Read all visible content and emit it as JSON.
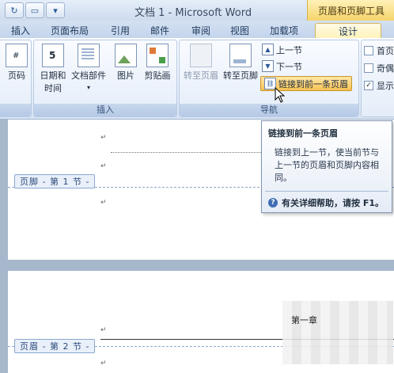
{
  "title_bar": {
    "window_title": "文档 1 - Microsoft Word",
    "context_tool_title": "页眉和页脚工具",
    "quick_access": {
      "redo_icon": "redo-icon",
      "dropdown_icon": "chevron-down-icon"
    }
  },
  "tabs": [
    "插入",
    "页面布局",
    "引用",
    "邮件",
    "审阅",
    "视图",
    "加载项",
    "设计"
  ],
  "active_tab": "设计",
  "ribbon": {
    "groups": {
      "left_partial": {
        "label": "页码",
        "group_label": ""
      },
      "insert": {
        "label": "插入",
        "buttons": [
          "日期和\n时间",
          "文档部件",
          "图片",
          "剪贴画"
        ]
      },
      "navigation": {
        "label": "导航",
        "big_buttons": [
          "转至页眉",
          "转至页脚"
        ],
        "small_buttons": [
          "上一节",
          "下一节",
          "链接到前一条页眉"
        ]
      },
      "options": {
        "checkboxes": [
          {
            "label": "首页",
            "checked": false
          },
          {
            "label": "奇偶",
            "checked": false
          },
          {
            "label": "显示",
            "checked": true
          }
        ]
      }
    }
  },
  "tooltip": {
    "title": "链接到前一条页眉",
    "body": "链接到上一节，使当前节与上一节的页眉和页脚内容相同。",
    "help": "有关详细帮助，请按 F1。"
  },
  "document": {
    "footer_tag_1": "页脚 - 第 1 节 -",
    "header_tag_2": "页眉 - 第 2 节 -",
    "chapter_text": "第一章",
    "paragraph_mark": "↵"
  }
}
